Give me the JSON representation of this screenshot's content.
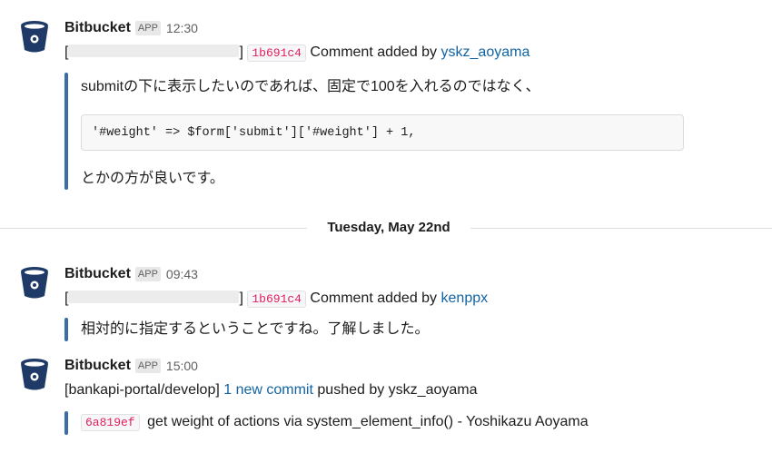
{
  "messages": [
    {
      "sender": "Bitbucket",
      "app_badge": "APP",
      "time": "12:30",
      "redacted_prefix": "[",
      "redacted_suffix": "]",
      "commit_hash": "1b691c4",
      "event_text": "Comment added by",
      "user": "yskz_aoyama",
      "quote_line_1": "submitの下に表示したいのであれば、固定で100を入れるのではなく、",
      "code": "'#weight' => $form['submit']['#weight'] + 1,",
      "quote_line_2": "とかの方が良いです。"
    },
    {
      "sender": "Bitbucket",
      "app_badge": "APP",
      "time": "09:43",
      "redacted_prefix": "[",
      "redacted_suffix": "]",
      "commit_hash": "1b691c4",
      "event_text": "Comment added by",
      "user": "kenppx",
      "quote_line_1": "相対的に指定するということですね。了解しました。"
    },
    {
      "sender": "Bitbucket",
      "app_badge": "APP",
      "time": "15:00",
      "repo": "[bankapi-portal/develop]",
      "commit_link": "1 new commit",
      "pushed_text": "pushed by yskz_aoyama",
      "commit_hash": "6a819ef",
      "commit_message": "get weight of actions via system_element_info() - Yoshikazu Aoyama"
    }
  ],
  "date_divider": "Tuesday, May 22nd",
  "colors": {
    "link": "#1264a3",
    "hash": "#e01e5a",
    "quote_bar": "#3a6ea5",
    "avatar": "#1f3a66"
  },
  "icons": {
    "avatar": "bitbucket-bucket-icon"
  }
}
